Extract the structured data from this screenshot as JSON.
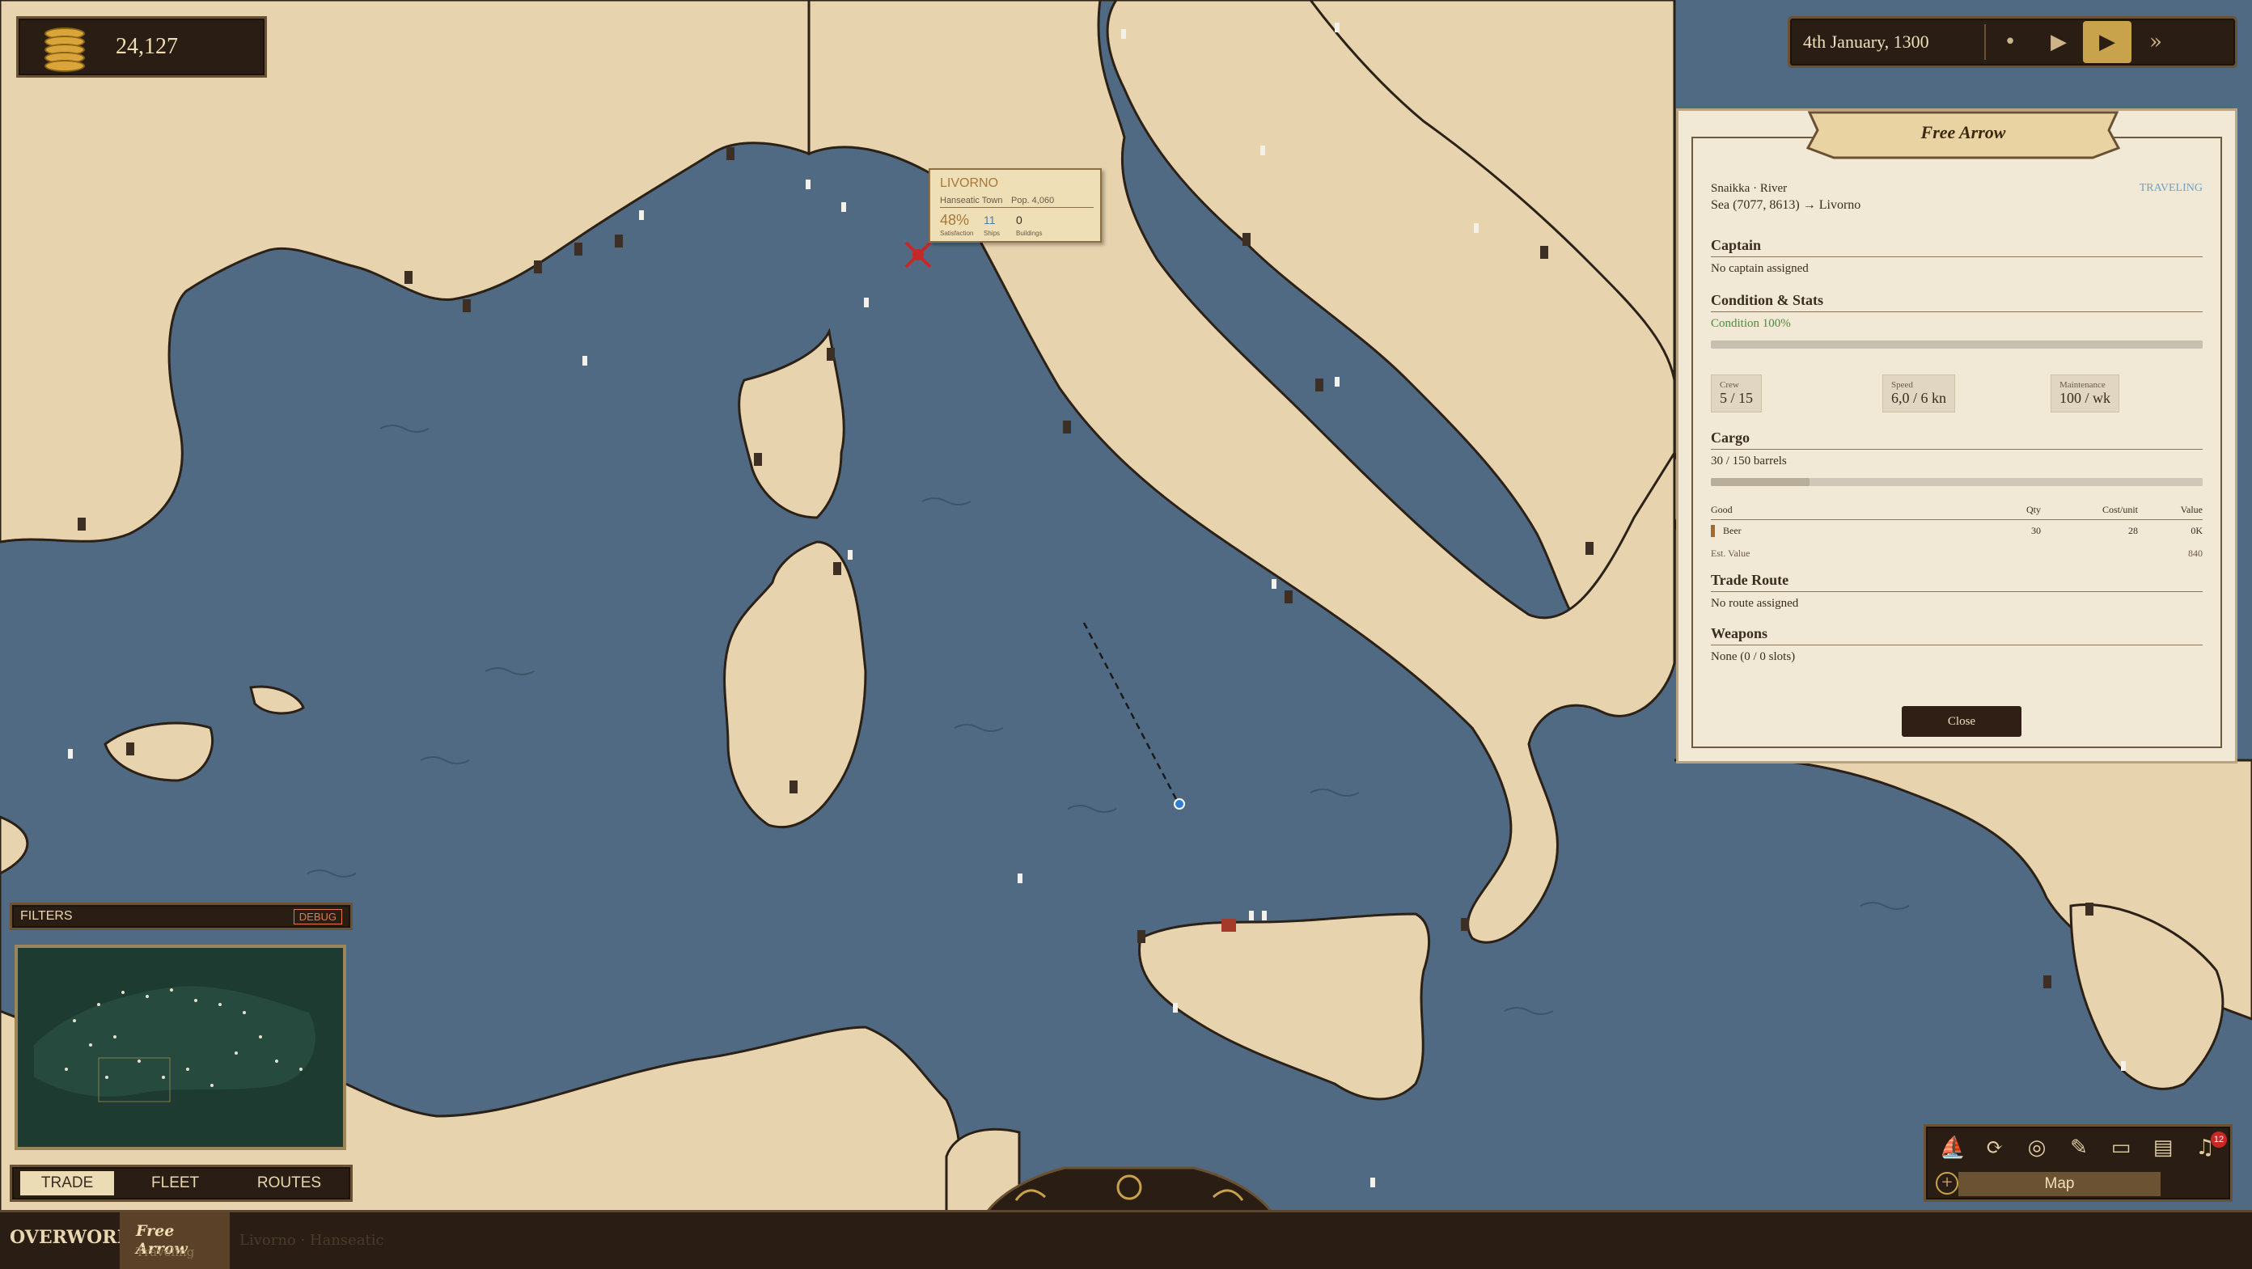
{
  "hud": {
    "gold": "24,127"
  },
  "time": {
    "date": "4th January, 1300",
    "pause_glyph": "•",
    "play_glyph": "▶",
    "fast_glyph": "▶▶",
    "fastest_glyph": "»"
  },
  "tooltip": {
    "town": "LIVORNO",
    "type": "Hanseatic Town",
    "pop": "Pop. 4,060",
    "satisfaction": "48%",
    "ships": "11",
    "buildings": "0",
    "satisfaction_label": "Satisfaction",
    "ships_label": "Ships",
    "buildings_label": "Buildings"
  },
  "ship": {
    "name": "Free Arrow",
    "type": "Snaikka · River",
    "status": "TRAVELING",
    "route": "Sea (7077, 8613) → Livorno",
    "captain_h": "Captain",
    "captain": "No captain assigned",
    "cond_h": "Condition & Stats",
    "condition": "Condition  100%",
    "condition_fraction": 1.0,
    "crew_l": "Crew",
    "crew": "5 / 15",
    "speed_l": "Speed",
    "speed": "6,0 / 6 kn",
    "maint_l": "Maintenance",
    "maint": "100 / wk",
    "cargo_h": "Cargo",
    "cargo": "30 / 150 barrels",
    "cargo_fraction": 0.2,
    "cols": {
      "good": "Good",
      "qty": "Qty",
      "cost": "Cost/unit",
      "value": "Value"
    },
    "row": {
      "good": "Beer",
      "qty": "30",
      "cost": "28",
      "value": "0K"
    },
    "est_label": "Est. Value",
    "est_value": "840",
    "route_h": "Trade Route",
    "route_v": "No route assigned",
    "weapons_h": "Weapons",
    "weapons": "None  (0 / 0 slots)",
    "close": "Close"
  },
  "filters": {
    "label": "FILTERS",
    "debug": "DEBUG"
  },
  "tabs": [
    "TRADE",
    "FLEET",
    "ROUTES"
  ],
  "bottom": {
    "overworld": "OVERWORLD",
    "ship_name": "Free Arrow",
    "ship_status": "Traveling",
    "faint": "Livorno · Hanseatic"
  },
  "toolbar": {
    "map": "Map",
    "badge": "12"
  }
}
